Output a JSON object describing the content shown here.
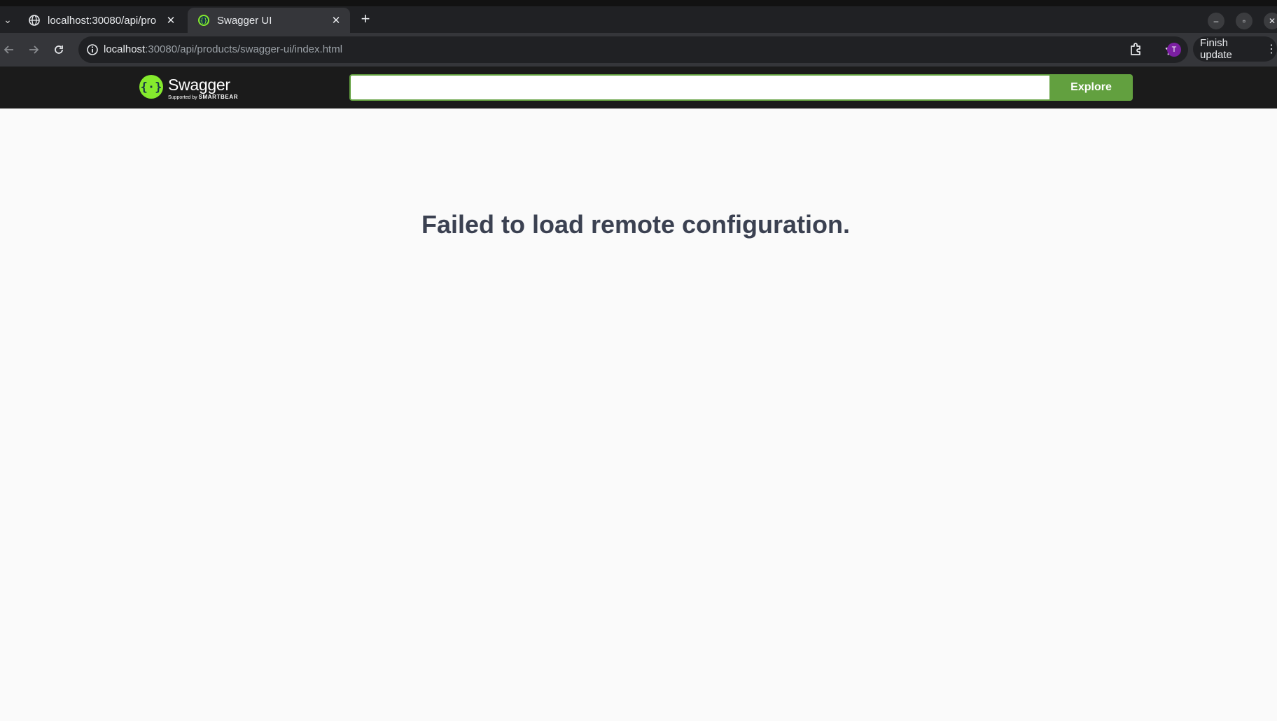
{
  "browser": {
    "tabs": [
      {
        "title": "localhost:30080/api/products/swagger-ui/index.html",
        "short_title": "localhost:30080/api/pro",
        "active": false
      },
      {
        "title": "Swagger UI",
        "active": true
      }
    ],
    "close_symbol": "✕",
    "new_tab_symbol": "+",
    "tab_search_symbol": "⌄",
    "url_host": "localhost",
    "url_path": ":30080/api/products/swagger-ui/index.html",
    "profile_initial": "T",
    "update_label": "Finish update",
    "menu_symbol": "⋮",
    "window_controls": {
      "minimize": "–",
      "maximize": "▫",
      "close": "✕"
    }
  },
  "swagger": {
    "logo_text": "Swagger",
    "logo_sub_prefix": "Supported by",
    "logo_sub_brand": "SMARTBEAR",
    "search_placeholder": "",
    "search_value": "",
    "explore_label": "Explore",
    "brand_color": "#62a03f"
  },
  "main": {
    "error_message": "Failed to load remote configuration."
  }
}
